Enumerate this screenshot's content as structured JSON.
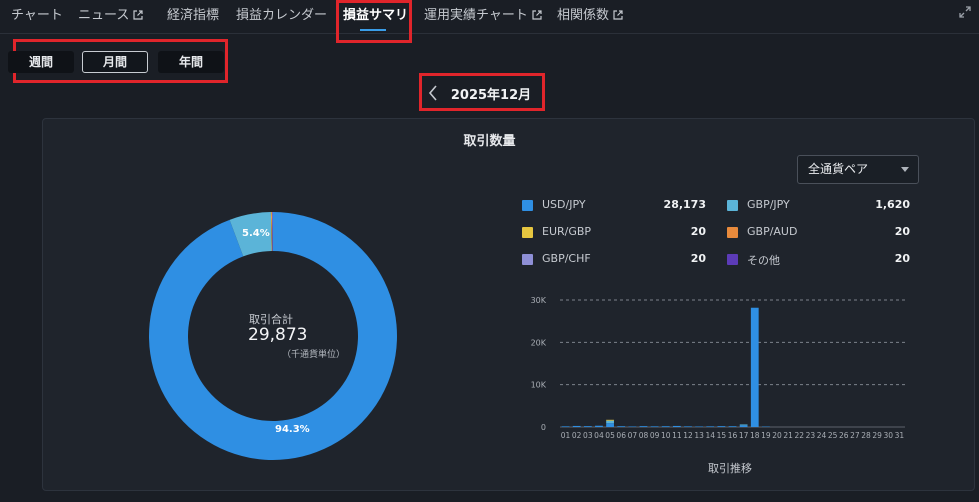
{
  "nav": {
    "items": [
      {
        "label": "チャート",
        "external": false
      },
      {
        "label": "ニュース",
        "external": true
      },
      {
        "label": "経済指標",
        "external": false
      },
      {
        "label": "損益カレンダー",
        "external": false
      },
      {
        "label": "損益サマリ",
        "external": false,
        "active": true
      },
      {
        "label": "運用実績チャート",
        "external": true
      },
      {
        "label": "相関係数",
        "external": true
      }
    ]
  },
  "period": {
    "weekly": "週間",
    "monthly": "月間",
    "yearly": "年間",
    "selected": "monthly"
  },
  "month": {
    "label": "2025年12月"
  },
  "panel": {
    "title": "取引数量",
    "pair_select": "全通貨ペア"
  },
  "donut": {
    "center_label": "取引合計",
    "center_value": "29,873",
    "center_unit": "（千通貨単位）",
    "pct_major": "94.3%",
    "pct_minor": "5.4%"
  },
  "colors": {
    "usd_jpy": "#2f8fe3",
    "gbp_jpy": "#5bb4d8",
    "eur_gbp": "#e6c640",
    "gbp_aud": "#e88a3c",
    "gbp_chf": "#8e8fd6",
    "other": "#5c3bb8"
  },
  "chart_data": [
    {
      "type": "pie",
      "title": "取引数量",
      "slices": [
        {
          "name": "USD/JPY",
          "value": 28173,
          "display": "28,173",
          "color": "#2f8fe3"
        },
        {
          "name": "GBP/JPY",
          "value": 1620,
          "display": "1,620",
          "color": "#5bb4d8"
        },
        {
          "name": "EUR/GBP",
          "value": 20,
          "display": "20",
          "color": "#e6c640"
        },
        {
          "name": "GBP/AUD",
          "value": 20,
          "display": "20",
          "color": "#e88a3c"
        },
        {
          "name": "GBP/CHF",
          "value": 20,
          "display": "20",
          "color": "#8e8fd6"
        },
        {
          "name": "その他",
          "value": 20,
          "display": "20",
          "color": "#5c3bb8"
        }
      ]
    },
    {
      "type": "bar",
      "title": "",
      "xlabel": "取引推移",
      "ylabel": "",
      "ylim": [
        0,
        30000
      ],
      "yticks": [
        {
          "value": 0,
          "label": "0"
        },
        {
          "value": 10000,
          "label": "10K"
        },
        {
          "value": 20000,
          "label": "20K"
        },
        {
          "value": 30000,
          "label": "30K"
        }
      ],
      "categories": [
        "01",
        "02",
        "03",
        "04",
        "05",
        "06",
        "07",
        "08",
        "09",
        "10",
        "11",
        "12",
        "13",
        "14",
        "15",
        "16",
        "17",
        "18",
        "19",
        "20",
        "21",
        "22",
        "23",
        "24",
        "25",
        "26",
        "27",
        "28",
        "29",
        "30",
        "31"
      ],
      "series": [
        {
          "color": "#2f8fe3",
          "values": [
            150,
            250,
            200,
            300,
            900,
            180,
            120,
            200,
            150,
            180,
            250,
            150,
            120,
            150,
            200,
            180,
            400,
            28173,
            100,
            0,
            0,
            0,
            0,
            0,
            0,
            0,
            0,
            0,
            0,
            0,
            0
          ]
        },
        {
          "color": "#5bb4d8",
          "values": [
            0,
            0,
            0,
            0,
            600,
            0,
            0,
            0,
            0,
            0,
            0,
            0,
            0,
            0,
            0,
            0,
            200,
            0,
            0,
            0,
            0,
            0,
            0,
            0,
            0,
            0,
            0,
            0,
            0,
            0,
            0
          ]
        },
        {
          "color": "#e6c640",
          "values": [
            0,
            0,
            0,
            0,
            200,
            0,
            0,
            0,
            0,
            0,
            0,
            0,
            0,
            0,
            0,
            0,
            0,
            0,
            0,
            0,
            0,
            0,
            0,
            0,
            0,
            0,
            0,
            0,
            0,
            0,
            0
          ]
        }
      ]
    }
  ]
}
